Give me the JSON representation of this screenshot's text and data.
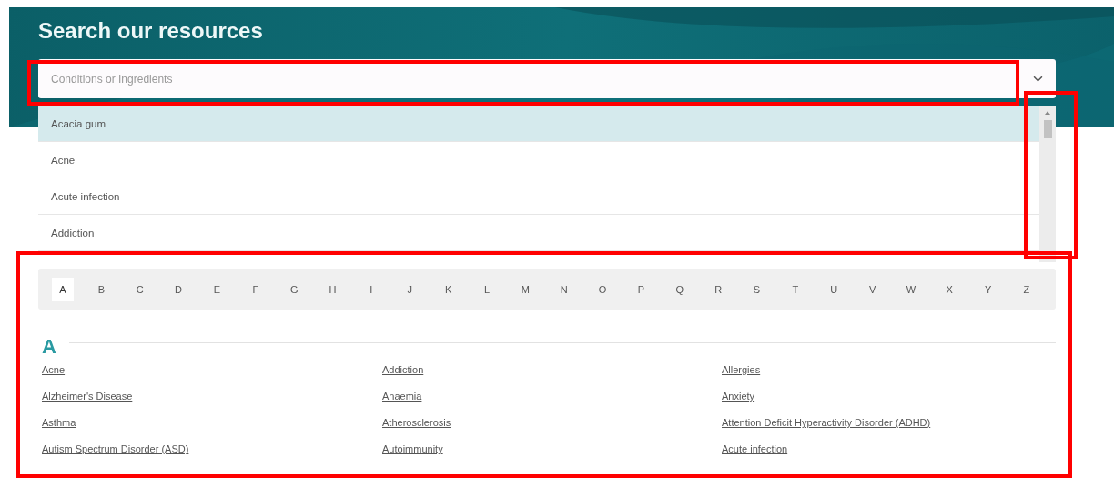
{
  "title": "Search our resources",
  "search": {
    "placeholder": "Conditions or Ingredients"
  },
  "dropdown": {
    "options": [
      {
        "label": "Acacia gum",
        "selected": true
      },
      {
        "label": "Acne",
        "selected": false
      },
      {
        "label": "Acute infection",
        "selected": false
      },
      {
        "label": "Addiction",
        "selected": false
      }
    ]
  },
  "alphabet": [
    {
      "letter": "A",
      "selected": true
    },
    {
      "letter": "B",
      "selected": false
    },
    {
      "letter": "C",
      "selected": false
    },
    {
      "letter": "D",
      "selected": false
    },
    {
      "letter": "E",
      "selected": false
    },
    {
      "letter": "F",
      "selected": false
    },
    {
      "letter": "G",
      "selected": false
    },
    {
      "letter": "H",
      "selected": false
    },
    {
      "letter": "I",
      "selected": false
    },
    {
      "letter": "J",
      "selected": false
    },
    {
      "letter": "K",
      "selected": false
    },
    {
      "letter": "L",
      "selected": false
    },
    {
      "letter": "M",
      "selected": false
    },
    {
      "letter": "N",
      "selected": false
    },
    {
      "letter": "O",
      "selected": false
    },
    {
      "letter": "P",
      "selected": false
    },
    {
      "letter": "Q",
      "selected": false
    },
    {
      "letter": "R",
      "selected": false
    },
    {
      "letter": "S",
      "selected": false
    },
    {
      "letter": "T",
      "selected": false
    },
    {
      "letter": "U",
      "selected": false
    },
    {
      "letter": "V",
      "selected": false
    },
    {
      "letter": "W",
      "selected": false
    },
    {
      "letter": "X",
      "selected": false
    },
    {
      "letter": "Y",
      "selected": false
    },
    {
      "letter": "Z",
      "selected": false
    }
  ],
  "section": {
    "heading": "A",
    "links": [
      "Acne",
      "Addiction",
      "Allergies",
      "Alzheimer's Disease",
      "Anaemia",
      "Anxiety",
      "Asthma",
      "Atherosclerosis",
      "Attention Deficit Hyperactivity Disorder (ADHD)",
      "Autism Spectrum Disorder (ASD)",
      "Autoimmunity",
      "Acute infection"
    ]
  }
}
